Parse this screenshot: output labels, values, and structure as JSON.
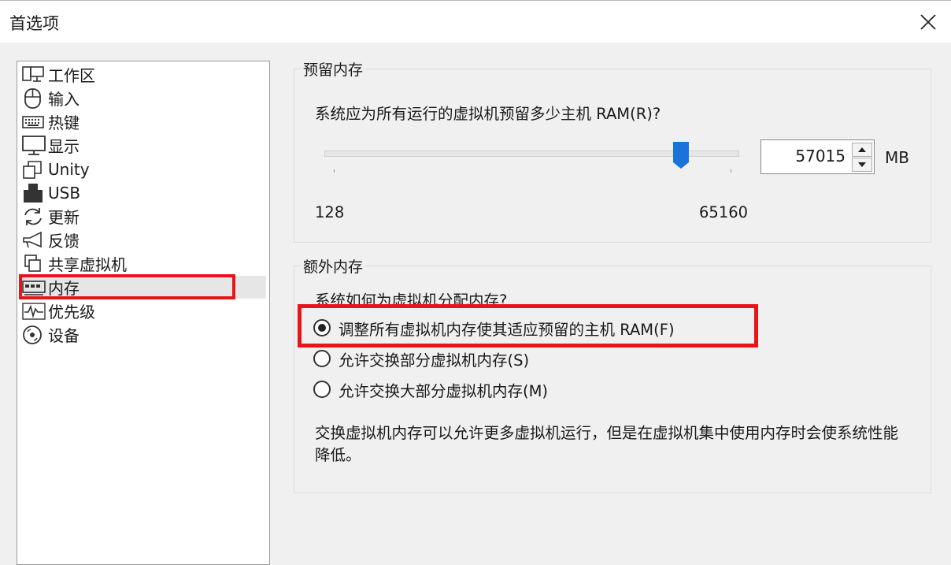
{
  "window": {
    "title": "首选项"
  },
  "sidebar": {
    "items": [
      {
        "label": "工作区",
        "icon": "workspace-icon"
      },
      {
        "label": "输入",
        "icon": "mouse-icon"
      },
      {
        "label": "热键",
        "icon": "keyboard-icon"
      },
      {
        "label": "显示",
        "icon": "monitor-icon"
      },
      {
        "label": "Unity",
        "icon": "unity-icon"
      },
      {
        "label": "USB",
        "icon": "usb-icon"
      },
      {
        "label": "更新",
        "icon": "update-icon"
      },
      {
        "label": "反馈",
        "icon": "megaphone-icon"
      },
      {
        "label": "共享虚拟机",
        "icon": "shared-vm-icon"
      },
      {
        "label": "内存",
        "icon": "memory-icon",
        "selected": true
      },
      {
        "label": "优先级",
        "icon": "priority-icon"
      },
      {
        "label": "设备",
        "icon": "devices-icon"
      }
    ]
  },
  "reserved_memory": {
    "title": "预留内存",
    "question": "系统应为所有运行的虚拟机预留多少主机 RAM(R)?",
    "slider_min_label": "128",
    "slider_max_label": "65160",
    "slider_value_fraction": 0.875,
    "value": "57015",
    "unit": "MB"
  },
  "additional_memory": {
    "title": "额外内存",
    "question": "系统如何为虚拟机分配内存?",
    "options": [
      {
        "label": "调整所有虚拟机内存使其适应预留的主机 RAM(F)",
        "checked": true
      },
      {
        "label": "允许交换部分虚拟机内存(S)",
        "checked": false
      },
      {
        "label": "允许交换大部分虚拟机内存(M)",
        "checked": false
      }
    ],
    "description": "交换虚拟机内存可以允许更多虚拟机运行，但是在虚拟机集中使用内存时会使系统性能降低。"
  },
  "colors": {
    "highlight": "#e8141b",
    "slider_thumb": "#1a73d9"
  }
}
